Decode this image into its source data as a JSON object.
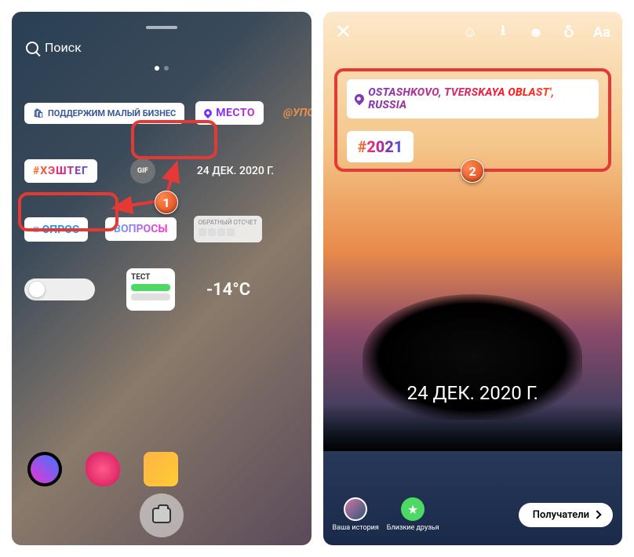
{
  "left": {
    "search_placeholder": "Поиск",
    "stickers": {
      "small_business": "ПОДДЕРЖИМ МАЛЫЙ БИЗНЕС",
      "location": "МЕСТО",
      "mention": "@УПОМИНАНИЕ",
      "hashtag": "#ХЭШТЕГ",
      "date": "24 ДЕК. 2020 Г.",
      "poll": "≡ ОПРОС",
      "questions": "ВОПРОСЫ",
      "countdown": "ОБРАТНЫЙ ОТСЧЕТ",
      "test": "ТЕСТ",
      "temperature": "-14°C",
      "gif": "GIF"
    }
  },
  "right": {
    "location": "OSTASHKOVO, TVERSKAYA OBLAST', RUSSIA",
    "hashtag": "#2021",
    "date": "24 ДЕК. 2020 Г.",
    "your_story": "Ваша история",
    "close_friends": "Близкие друзья",
    "recipients": "Получатели",
    "text_tool": "Aa"
  },
  "markers": {
    "one": "1",
    "two": "2"
  }
}
